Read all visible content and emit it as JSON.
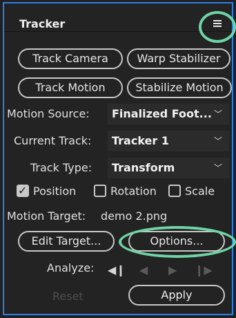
{
  "panel": {
    "title": "Tracker"
  },
  "buttons": {
    "track_camera": "Track Camera",
    "warp_stabilizer": "Warp Stabilizer",
    "track_motion": "Track Motion",
    "stabilize_motion": "Stabilize Motion"
  },
  "motion_source": {
    "label": "Motion Source:",
    "value": "Finalized Foot..."
  },
  "current_track": {
    "label": "Current Track:",
    "value": "Tracker 1"
  },
  "track_type": {
    "label": "Track Type:",
    "value": "Transform"
  },
  "checkboxes": [
    {
      "label": "Position",
      "checked": true
    },
    {
      "label": "Rotation",
      "checked": false
    },
    {
      "label": "Scale",
      "checked": false
    }
  ],
  "motion_target": {
    "label": "Motion Target:",
    "value": "demo 2.png"
  },
  "edit_target": "Edit Target...",
  "options": "Options...",
  "analyze": {
    "label": "Analyze:",
    "glyphs": [
      "◀❙",
      "◀",
      "▶",
      "❙▶"
    ]
  },
  "reset": "Reset",
  "apply": "Apply",
  "highlight_color": "#6ed4a6",
  "panel_border_color": "#2f7fe0"
}
